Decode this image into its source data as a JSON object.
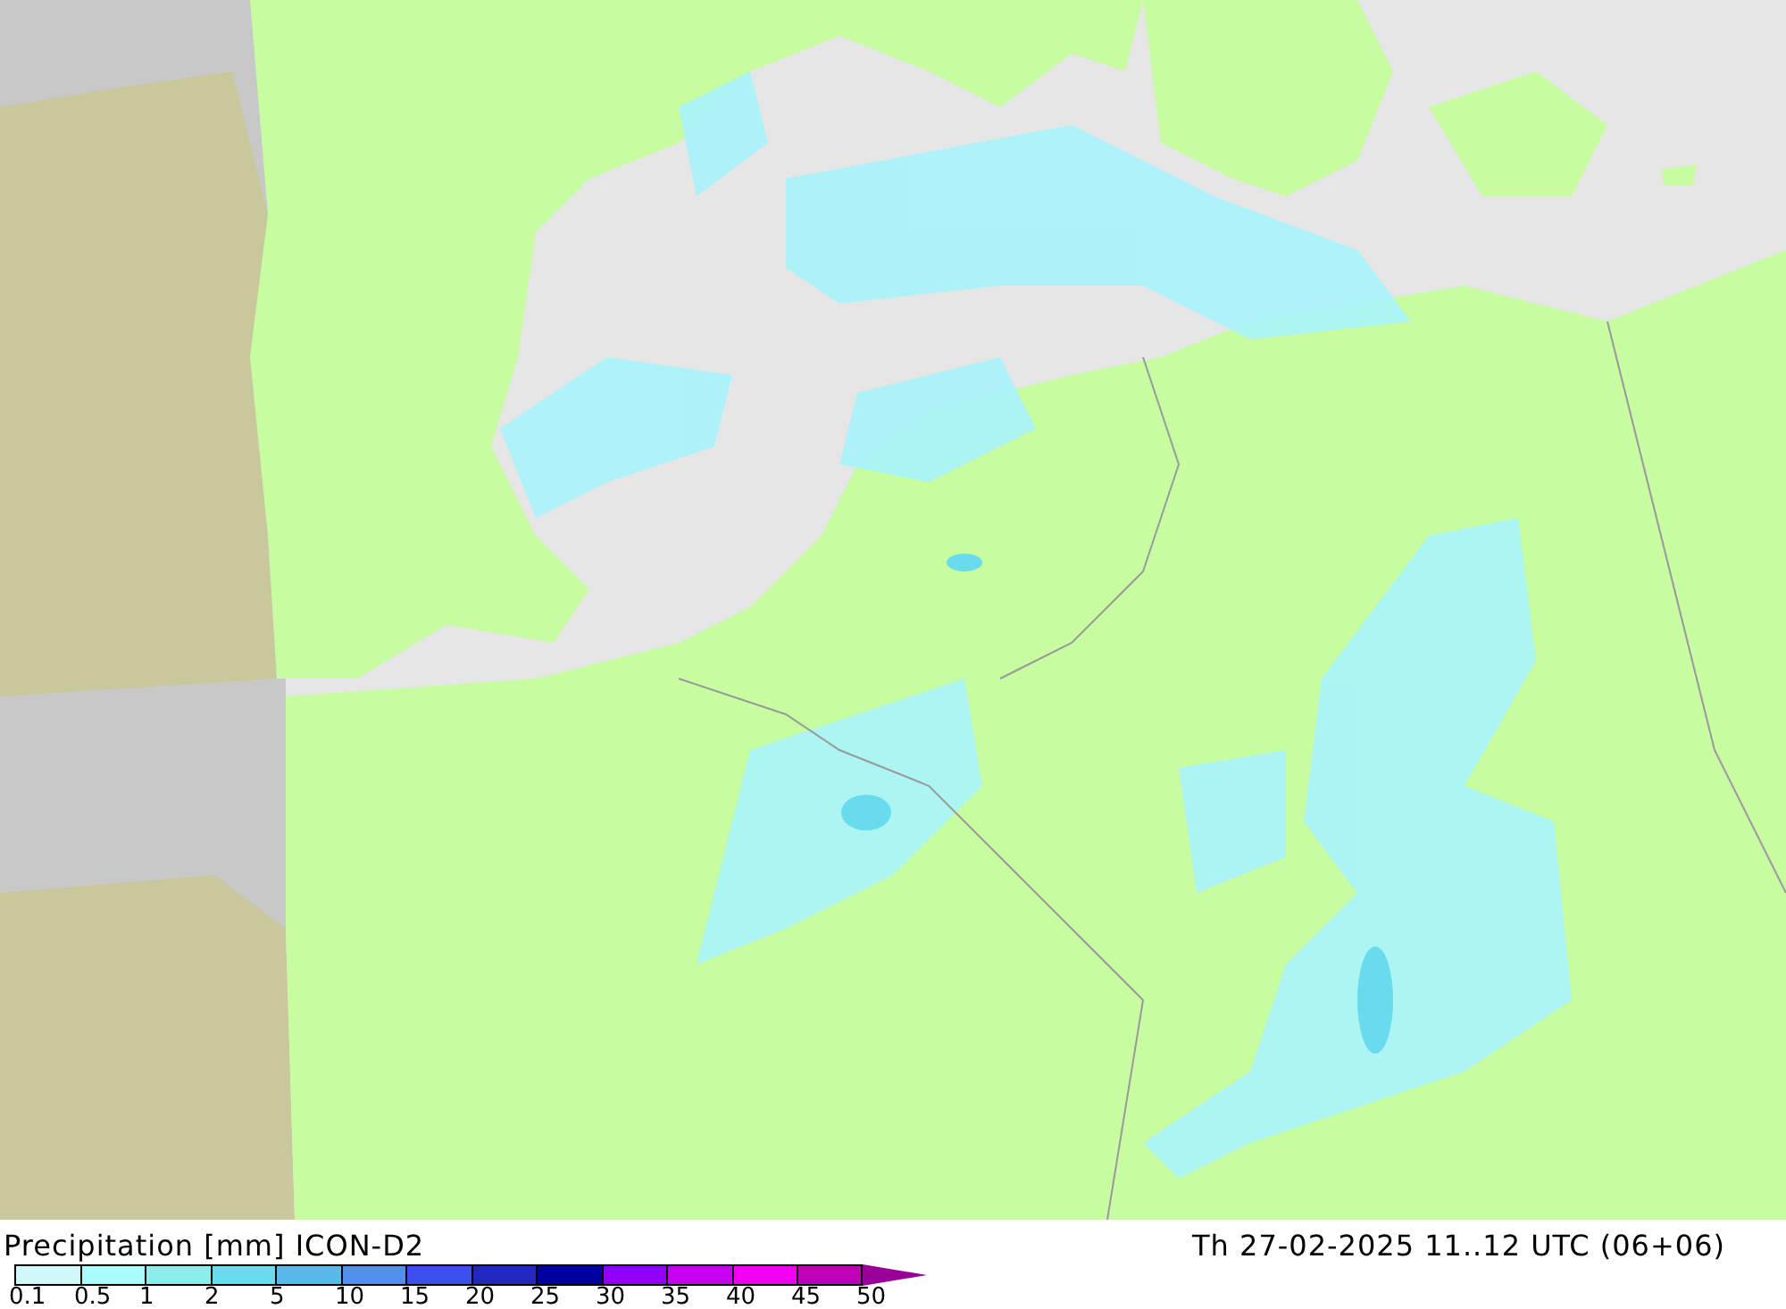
{
  "map": {
    "title": "Precipitation [mm] ICON-D2",
    "valid_time": "Th 27-02-2025 11..12 UTC (06+06)"
  },
  "legend": {
    "colors": [
      {
        "kind": "cell",
        "color": "#d0f8f8"
      },
      {
        "kind": "cell",
        "color": "#a8fcfc"
      },
      {
        "kind": "cell",
        "color": "#8ceeea"
      },
      {
        "kind": "cell",
        "color": "#68dced"
      },
      {
        "kind": "cell",
        "color": "#58b8ea"
      },
      {
        "kind": "cell",
        "color": "#5090e8"
      },
      {
        "kind": "cell",
        "color": "#3c50f0"
      },
      {
        "kind": "cell",
        "color": "#2028c0"
      },
      {
        "kind": "cell",
        "color": "#0000a0"
      },
      {
        "kind": "cell",
        "color": "#9000f8"
      },
      {
        "kind": "cell",
        "color": "#c800f0"
      },
      {
        "kind": "cell",
        "color": "#f000f0"
      },
      {
        "kind": "cell",
        "color": "#c000b8"
      },
      {
        "kind": "arrow",
        "color": "#980098"
      }
    ],
    "labels": [
      "0.1",
      "0.5",
      "1",
      "2",
      "5",
      "10",
      "15",
      "20",
      "25",
      "30",
      "35",
      "40",
      "45",
      "50"
    ]
  }
}
